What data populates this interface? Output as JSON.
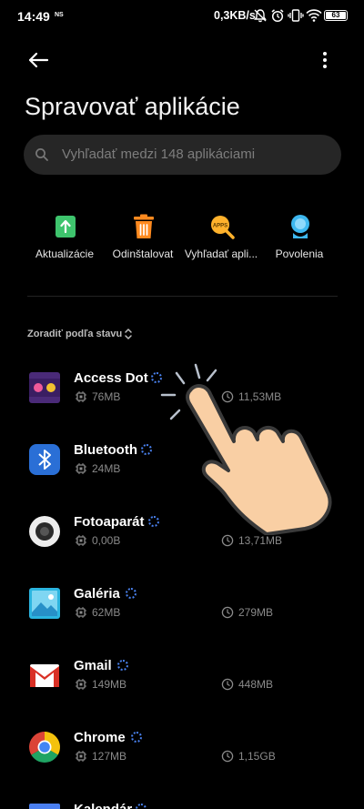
{
  "status": {
    "time": "14:49",
    "carrier": "NS",
    "network_speed": "0,3KB/s",
    "battery": "63"
  },
  "header": {
    "title": "Spravovať aplikácie"
  },
  "search": {
    "placeholder": "Vyhľadať medzi 148 aplikáciami"
  },
  "actions": [
    {
      "label": "Aktualizácie",
      "icon": "update-icon",
      "color": "#3ec46d"
    },
    {
      "label": "Odinštalovat",
      "icon": "trash-icon",
      "color": "#ff8a1f"
    },
    {
      "label": "Vyhľadať apli...",
      "icon": "apps-search-icon",
      "color": "#ffb22c"
    },
    {
      "label": "Povolenia",
      "icon": "permissions-icon",
      "color": "#3db7ef"
    }
  ],
  "sort": {
    "label": "Zoradiť podľa stavu"
  },
  "apps": [
    {
      "name": "Access Dot",
      "size": "76MB",
      "cache": "11,53MB",
      "icon": "access-dot-icon"
    },
    {
      "name": "Bluetooth",
      "size": "24MB",
      "cache": "",
      "icon": "bluetooth-icon"
    },
    {
      "name": "Fotoaparát",
      "size": "0,00B",
      "cache": "13,71MB",
      "icon": "camera-icon"
    },
    {
      "name": "Galéria",
      "size": "62MB",
      "cache": "279MB",
      "icon": "gallery-icon"
    },
    {
      "name": "Gmail",
      "size": "149MB",
      "cache": "448MB",
      "icon": "gmail-icon"
    },
    {
      "name": "Chrome",
      "size": "127MB",
      "cache": "1,15GB",
      "icon": "chrome-icon"
    },
    {
      "name": "Kalendár",
      "size": "",
      "cache": "",
      "icon": "calendar-icon"
    }
  ]
}
